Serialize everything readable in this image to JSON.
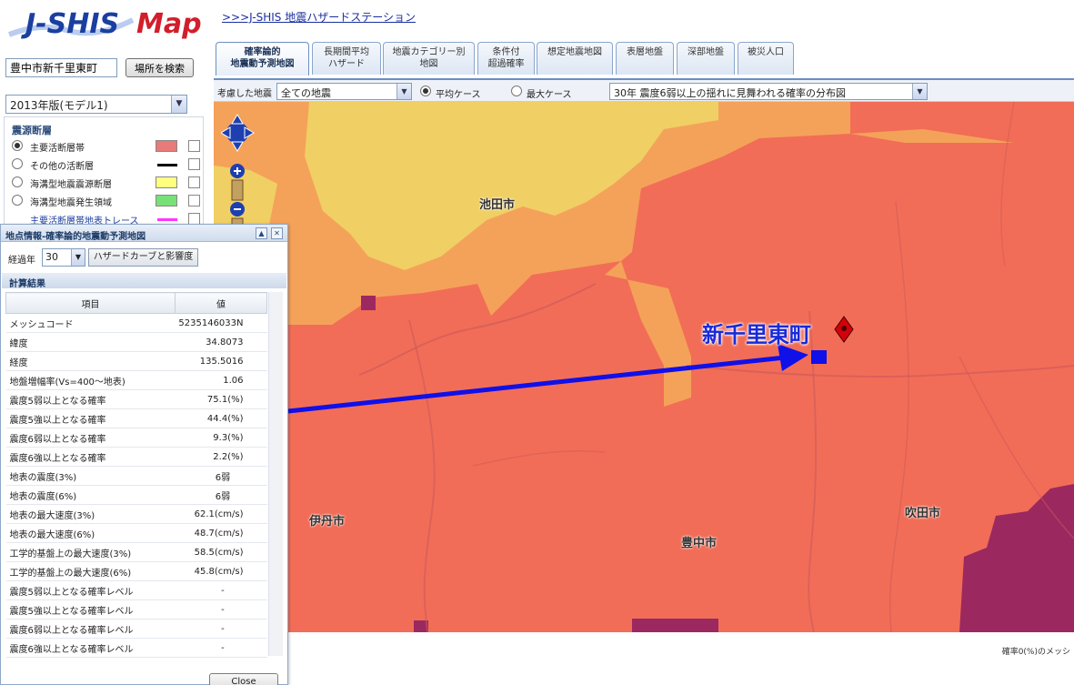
{
  "logo": {
    "brand": "J-SHIS",
    "word": "Map",
    "brand_color": "#1a3fa0",
    "map_color": "#d21e2b"
  },
  "top_link": ">>>J-SHIS 地震ハザードステーション",
  "search": {
    "value": "豊中市新千里東町",
    "button": "場所を検索"
  },
  "model": {
    "selected": "2013年版(モデル1)"
  },
  "layers": {
    "heading": "震源断層",
    "items": [
      {
        "label": "主要活断層帯",
        "color": "#e87a7a"
      },
      {
        "label": "その他の活断層",
        "color": "#000000"
      },
      {
        "label": "海溝型地震震源断層",
        "color": "#ffff80"
      },
      {
        "label": "海溝型地震発生領域",
        "color": "#77e077"
      },
      {
        "label": "主要活断層帯地表トレース",
        "color": "#ff33ff"
      }
    ]
  },
  "tabs": [
    {
      "line1": "確率論的",
      "line2": "地震動予測地図"
    },
    {
      "line1": "長期間平均",
      "line2": "ハザード"
    },
    {
      "line1": "地震カテゴリー別",
      "line2": "地図"
    },
    {
      "line1": "条件付",
      "line2": "超過確率"
    },
    {
      "line1": "想定地震地図",
      "line2": ""
    },
    {
      "line1": "表層地盤",
      "line2": ""
    },
    {
      "line1": "深部地盤",
      "line2": ""
    },
    {
      "line1": "被災人口",
      "line2": ""
    }
  ],
  "toolbar": {
    "label": "考慮した地震",
    "quake_select": "全ての地震",
    "radio_avg": "平均ケース",
    "radio_max": "最大ケース",
    "map_select": "30年 震度6弱以上の揺れに見舞われる確率の分布図"
  },
  "map": {
    "place_label": "新千里東町",
    "cities": [
      "池田市",
      "伊丹市",
      "豊中市",
      "吹田市"
    ],
    "footer": "確率0(%)のメッシ",
    "colors": {
      "red": "#f26d57",
      "orange": "#f4a259",
      "yellow": "#f0cf64",
      "purple": "#9c2860",
      "arrow": "#1010e8"
    }
  },
  "popup": {
    "title": "地点情報-確率論的地震動予測地図",
    "period_label": "経過年",
    "period_value": "30",
    "hazard_button": "ハザードカーブと影響度",
    "results_heading": "計算結果",
    "col_item": "項目",
    "col_value": "値",
    "rows": [
      {
        "item": "メッシュコード",
        "value": "5235146033N"
      },
      {
        "item": "緯度",
        "value": "34.8073"
      },
      {
        "item": "経度",
        "value": "135.5016"
      },
      {
        "item": "地盤増幅率(Vs=400〜地表)",
        "value": "1.06"
      },
      {
        "item": "震度5弱以上となる確率",
        "value": "75.1(%)"
      },
      {
        "item": "震度5強以上となる確率",
        "value": "44.4(%)"
      },
      {
        "item": "震度6弱以上となる確率",
        "value": "9.3(%)"
      },
      {
        "item": "震度6強以上となる確率",
        "value": "2.2(%)"
      },
      {
        "item": "地表の震度(3%)",
        "value": "6弱"
      },
      {
        "item": "地表の震度(6%)",
        "value": "6弱"
      },
      {
        "item": "地表の最大速度(3%)",
        "value": "62.1(cm/s)"
      },
      {
        "item": "地表の最大速度(6%)",
        "value": "48.7(cm/s)"
      },
      {
        "item": "工学的基盤上の最大速度(3%)",
        "value": "58.5(cm/s)"
      },
      {
        "item": "工学的基盤上の最大速度(6%)",
        "value": "45.8(cm/s)"
      },
      {
        "item": "震度5弱以上となる確率レベル",
        "value": "-"
      },
      {
        "item": "震度5強以上となる確率レベル",
        "value": "-"
      },
      {
        "item": "震度6弱以上となる確率レベル",
        "value": "-"
      },
      {
        "item": "震度6強以上となる確率レベル",
        "value": "-"
      }
    ],
    "close": "Close"
  }
}
